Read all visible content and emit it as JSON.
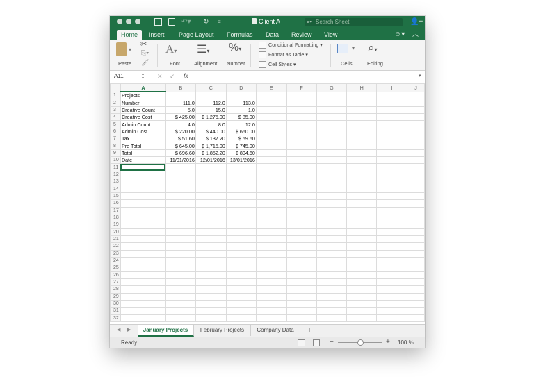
{
  "window": {
    "title": "Client A",
    "search_placeholder": "Search Sheet"
  },
  "ribbon_tabs": [
    "Home",
    "Insert",
    "Page Layout",
    "Formulas",
    "Data",
    "Review",
    "View"
  ],
  "ribbon": {
    "paste": "Paste",
    "font": "Font",
    "alignment": "Alignment",
    "number": "Number",
    "conditional_formatting": "Conditional Formatting",
    "format_as_table": "Format as Table",
    "cell_styles": "Cell Styles",
    "cells": "Cells",
    "editing": "Editing"
  },
  "formula_bar": {
    "name_box": "A11",
    "fx": "fx"
  },
  "columns": [
    "A",
    "B",
    "C",
    "D",
    "E",
    "F",
    "G",
    "H",
    "I",
    "J"
  ],
  "rows": [
    {
      "n": "1",
      "cells": [
        "Projects",
        "",
        "",
        ""
      ]
    },
    {
      "n": "2",
      "cells": [
        "Number",
        "111.0",
        "112.0",
        "113.0"
      ]
    },
    {
      "n": "3",
      "cells": [
        "Creative Count",
        "5.0",
        "15.0",
        "1.0"
      ]
    },
    {
      "n": "4",
      "cells": [
        "Creative Cost",
        "$ 425.00",
        "$ 1,275.00",
        "$ 85.00"
      ]
    },
    {
      "n": "5",
      "cells": [
        "Admin Count",
        "4.0",
        "8.0",
        "12.0"
      ]
    },
    {
      "n": "6",
      "cells": [
        "Admin Cost",
        "$ 220.00",
        "$ 440.00",
        "$ 660.00"
      ]
    },
    {
      "n": "7",
      "cells": [
        "Tax",
        "$ 51.60",
        "$ 137.20",
        "$ 59.60"
      ]
    },
    {
      "n": "8",
      "cells": [
        "Pre Total",
        "$ 645.00",
        "$ 1,715.00",
        "$ 745.00"
      ]
    },
    {
      "n": "9",
      "cells": [
        "Total",
        "$ 696.60",
        "$ 1,852.20",
        "$ 804.60"
      ]
    },
    {
      "n": "10",
      "cells": [
        "Date",
        "11/01/2016",
        "12/01/2016",
        "13/01/2016"
      ]
    },
    {
      "n": "11",
      "cells": [
        "",
        "",
        "",
        ""
      ]
    },
    {
      "n": "12",
      "cells": [
        "",
        "",
        "",
        ""
      ]
    },
    {
      "n": "13",
      "cells": [
        "",
        "",
        "",
        ""
      ]
    },
    {
      "n": "14",
      "cells": [
        "",
        "",
        "",
        ""
      ]
    },
    {
      "n": "15",
      "cells": [
        "",
        "",
        "",
        ""
      ]
    },
    {
      "n": "16",
      "cells": [
        "",
        "",
        "",
        ""
      ]
    },
    {
      "n": "17",
      "cells": [
        "",
        "",
        "",
        ""
      ]
    },
    {
      "n": "18",
      "cells": [
        "",
        "",
        "",
        ""
      ]
    },
    {
      "n": "19",
      "cells": [
        "",
        "",
        "",
        ""
      ]
    },
    {
      "n": "20",
      "cells": [
        "",
        "",
        "",
        ""
      ]
    },
    {
      "n": "21",
      "cells": [
        "",
        "",
        "",
        ""
      ]
    },
    {
      "n": "22",
      "cells": [
        "",
        "",
        "",
        ""
      ]
    },
    {
      "n": "23",
      "cells": [
        "",
        "",
        "",
        ""
      ]
    },
    {
      "n": "24",
      "cells": [
        "",
        "",
        "",
        ""
      ]
    },
    {
      "n": "25",
      "cells": [
        "",
        "",
        "",
        ""
      ]
    },
    {
      "n": "26",
      "cells": [
        "",
        "",
        "",
        ""
      ]
    },
    {
      "n": "27",
      "cells": [
        "",
        "",
        "",
        ""
      ]
    },
    {
      "n": "28",
      "cells": [
        "",
        "",
        "",
        ""
      ]
    },
    {
      "n": "29",
      "cells": [
        "",
        "",
        "",
        ""
      ]
    },
    {
      "n": "30",
      "cells": [
        "",
        "",
        "",
        ""
      ]
    },
    {
      "n": "31",
      "cells": [
        "",
        "",
        "",
        ""
      ]
    },
    {
      "n": "32",
      "cells": [
        "",
        "",
        "",
        ""
      ]
    }
  ],
  "selected_cell": "A11",
  "sheet_tabs": [
    "January Projects",
    "February Projects",
    "Company Data"
  ],
  "active_sheet": "January Projects",
  "add_sheet": "+",
  "status": {
    "ready": "Ready",
    "zoom": "100 %",
    "zoom_minus": "−",
    "zoom_plus": "+"
  },
  "colors": {
    "accent": "#1f7145"
  }
}
